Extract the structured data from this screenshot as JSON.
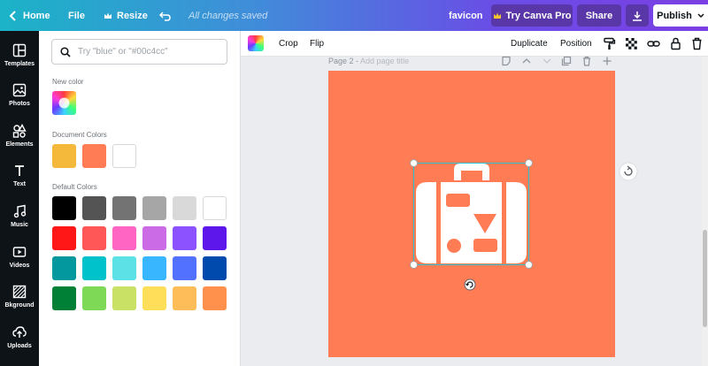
{
  "topbar": {
    "home_label": "Home",
    "file_label": "File",
    "resize_label": "Resize",
    "saved_status": "All changes saved",
    "doc_name": "favicon",
    "try_pro_label": "Try Canva Pro",
    "share_label": "Share",
    "publish_label": "Publish",
    "colors": {
      "gradient_start": "#1bb3c7",
      "gradient_end": "#7b3fe4",
      "pro_button": "#5a37a8",
      "publish_bg": "#ffffff"
    }
  },
  "rail": {
    "items": [
      {
        "label": "Templates",
        "icon": "templates-icon"
      },
      {
        "label": "Photos",
        "icon": "photos-icon"
      },
      {
        "label": "Elements",
        "icon": "elements-icon"
      },
      {
        "label": "Text",
        "icon": "text-icon"
      },
      {
        "label": "Music",
        "icon": "music-icon"
      },
      {
        "label": "Videos",
        "icon": "videos-icon"
      },
      {
        "label": "Bkground",
        "icon": "background-icon"
      },
      {
        "label": "Uploads",
        "icon": "uploads-icon"
      }
    ]
  },
  "panel": {
    "search_placeholder": "Try \"blue\" or \"#00c4cc\"",
    "new_color_title": "New color",
    "document_colors_title": "Document Colors",
    "document_colors": [
      "#f4b93a",
      "#ff7c55",
      "#ffffff"
    ],
    "default_colors_title": "Default Colors",
    "default_colors": [
      [
        "#000000",
        "#545454",
        "#737373",
        "#a6a6a6",
        "#d9d9d9",
        "#ffffff"
      ],
      [
        "#ff1616",
        "#ff5757",
        "#ff66c4",
        "#cb6ce6",
        "#8c52ff",
        "#5e17eb"
      ],
      [
        "#03989e",
        "#00c2cb",
        "#5ce1e6",
        "#38b6ff",
        "#5271ff",
        "#004aad"
      ],
      [
        "#008037",
        "#7ed957",
        "#c9e265",
        "#ffde59",
        "#ffbd59",
        "#ff914d"
      ]
    ]
  },
  "toolbar": {
    "crop_label": "Crop",
    "flip_label": "Flip",
    "duplicate_label": "Duplicate",
    "position_label": "Position"
  },
  "canvas": {
    "page_label": "Page 2 - ",
    "page_title_placeholder": "Add page title",
    "page_color": "#ff7c55",
    "selection_color": "#27c2d3"
  }
}
